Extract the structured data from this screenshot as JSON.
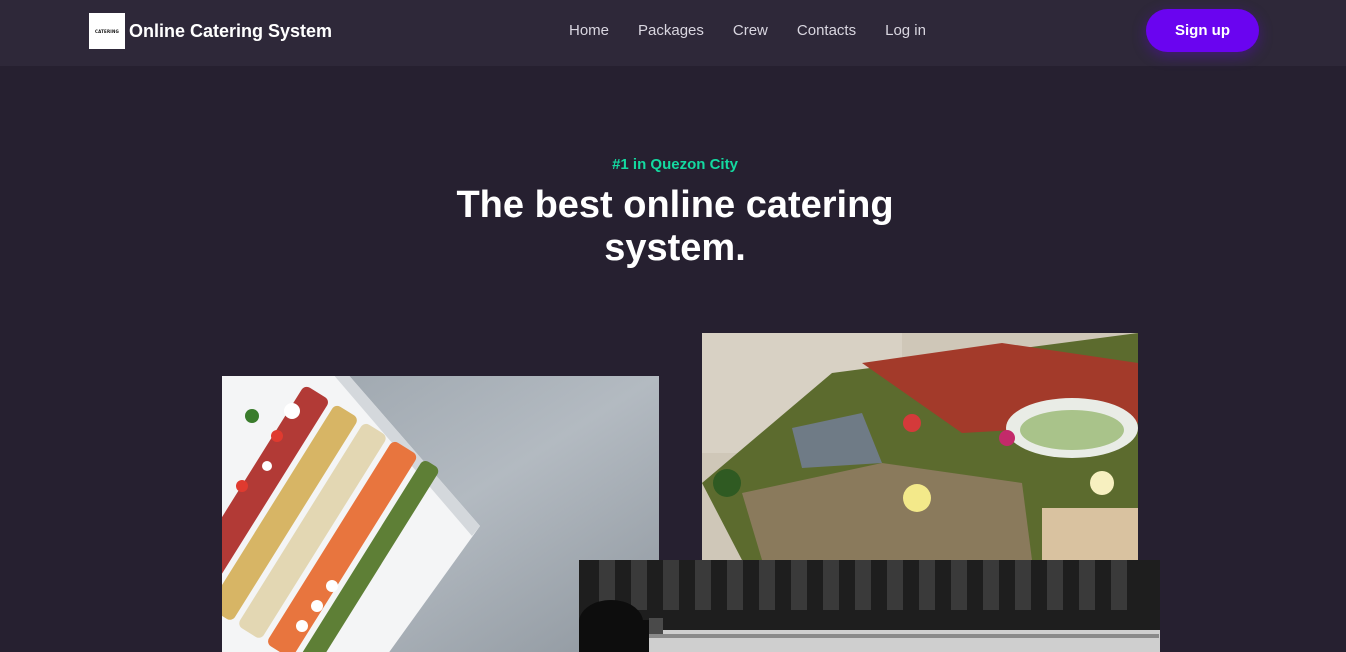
{
  "header": {
    "logo_text": "CATERING",
    "brand_name": "Online Catering System",
    "nav": [
      {
        "label": "Home"
      },
      {
        "label": "Packages"
      },
      {
        "label": "Crew"
      },
      {
        "label": "Contacts"
      },
      {
        "label": "Log in"
      }
    ],
    "signup_label": "Sign up"
  },
  "hero": {
    "kicker": "#1 in Quezon City",
    "title": "The best online catering system."
  },
  "colors": {
    "background": "#262030",
    "navbar": "#2e2839",
    "accent_button": "#6a04f0",
    "kicker": "#14d9a0"
  }
}
